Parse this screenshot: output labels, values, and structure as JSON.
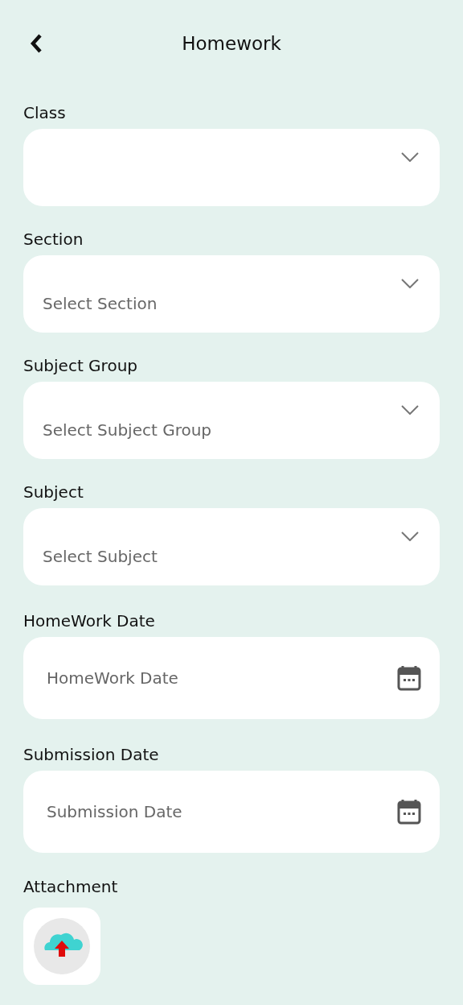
{
  "header": {
    "title": "Homework"
  },
  "fields": [
    {
      "kind": "dropdown",
      "label": "Class"
    },
    {
      "kind": "dropdown",
      "label": "Section",
      "placeholder": "Select Section"
    },
    {
      "kind": "dropdown",
      "label": "Subject Group",
      "placeholder": "Select Subject Group"
    },
    {
      "kind": "dropdown",
      "label": "Subject",
      "placeholder": "Select Subject"
    },
    {
      "kind": "date",
      "label": "HomeWork Date",
      "placeholder": "HomeWork Date"
    },
    {
      "kind": "date",
      "label": "Submission Date",
      "placeholder": "Submission Date"
    }
  ],
  "attachment": {
    "label": "Attachment"
  }
}
